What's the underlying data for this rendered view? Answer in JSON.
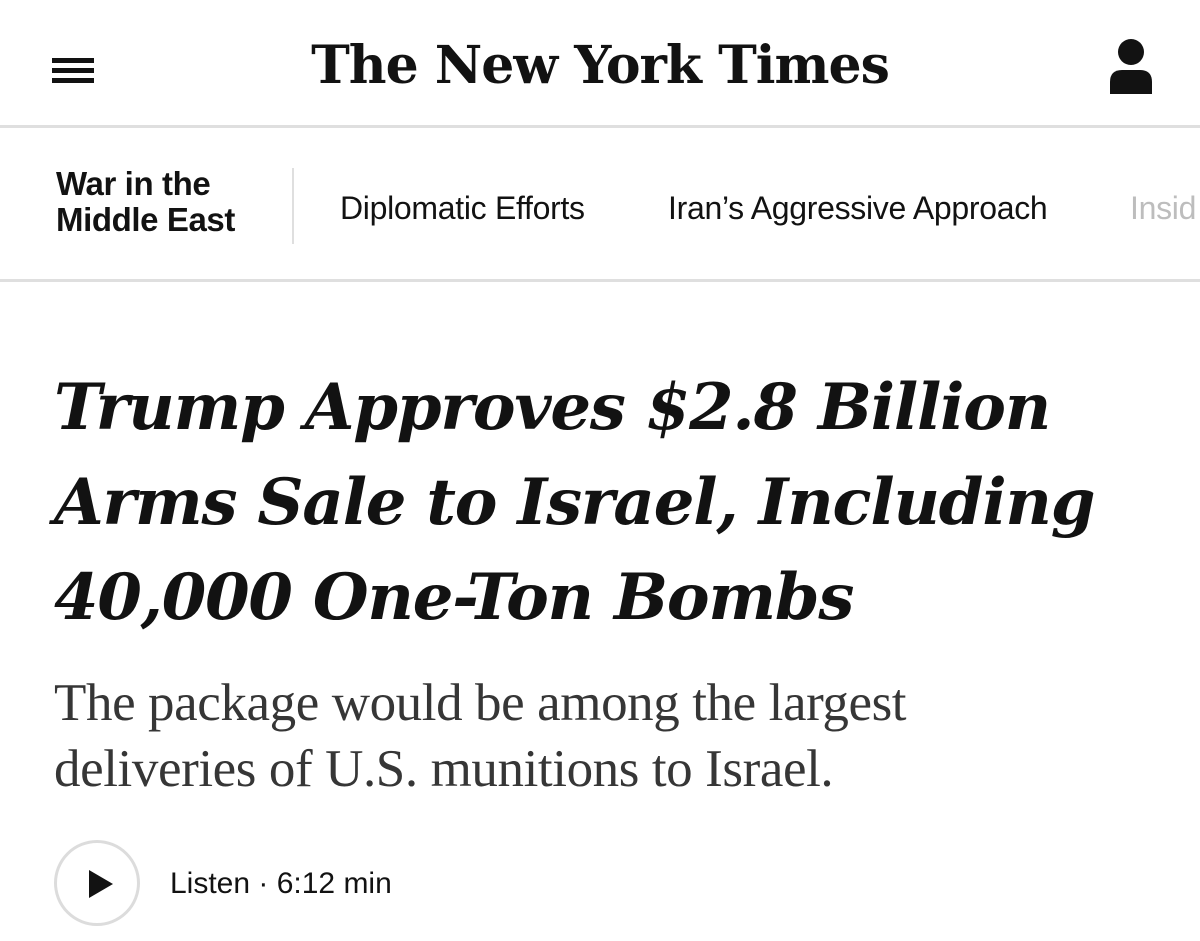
{
  "header": {
    "menu_icon": "hamburger-menu-icon",
    "masthead": "The New York Times",
    "account_icon": "user-account-icon"
  },
  "subnav": {
    "section_title_line1": "War in the",
    "section_title_line2": "Middle East",
    "links": [
      {
        "label": "Diplomatic Efforts"
      },
      {
        "label": "Iran’s Aggressive Approach"
      },
      {
        "label": "Insid"
      }
    ]
  },
  "article": {
    "headline": "Trump Approves $2.8 Billion Arms Sale to Israel, Including 40,000 One-Ton Bombs",
    "summary": "The package would be among the largest deliveries of U.S. munitions to Israel.",
    "audio": {
      "play_icon": "play-icon",
      "listen_label": "Listen · 6:12 min"
    }
  },
  "colors": {
    "text": "#121212",
    "summary_text": "#363636",
    "divider": "#dfdfdf",
    "faded_link": "#bdbdbd"
  }
}
